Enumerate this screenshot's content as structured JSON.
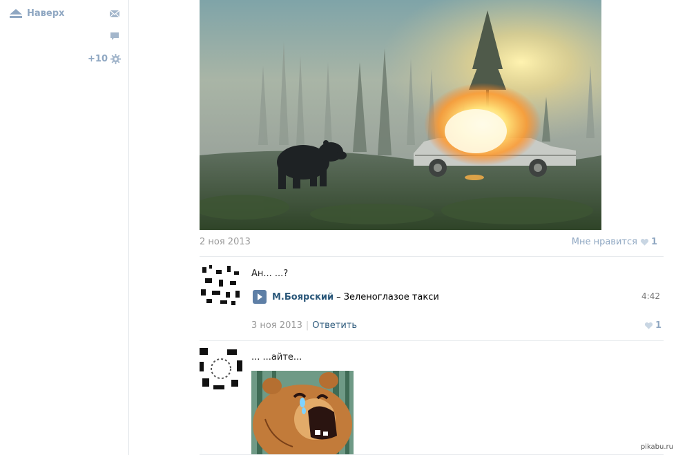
{
  "sidebar": {
    "up_label": "Наверх",
    "counter": "+10",
    "icons": {
      "up": "up-arrow-icon",
      "mail": "mail-icon",
      "chat": "chat-bubble-icon",
      "settings": "gear-icon"
    }
  },
  "post": {
    "date": "2 ноя 2013",
    "like_label": "Мне нравится",
    "like_count": "1"
  },
  "comments": [
    {
      "text": "Ан...  ...?",
      "audio": {
        "artist": "М.Боярский",
        "dash": "–",
        "title": "Зеленоглазое такси",
        "duration": "4:42"
      },
      "date": "3 ноя 2013",
      "reply": "Ответить",
      "like_count": "1"
    },
    {
      "text": "...  ...айте..."
    }
  ],
  "watermark": "pikabu.ru",
  "colors": {
    "link": "#2b587a",
    "muted": "#8fa7c2",
    "date": "#999999",
    "play": "#5e7fa6"
  }
}
